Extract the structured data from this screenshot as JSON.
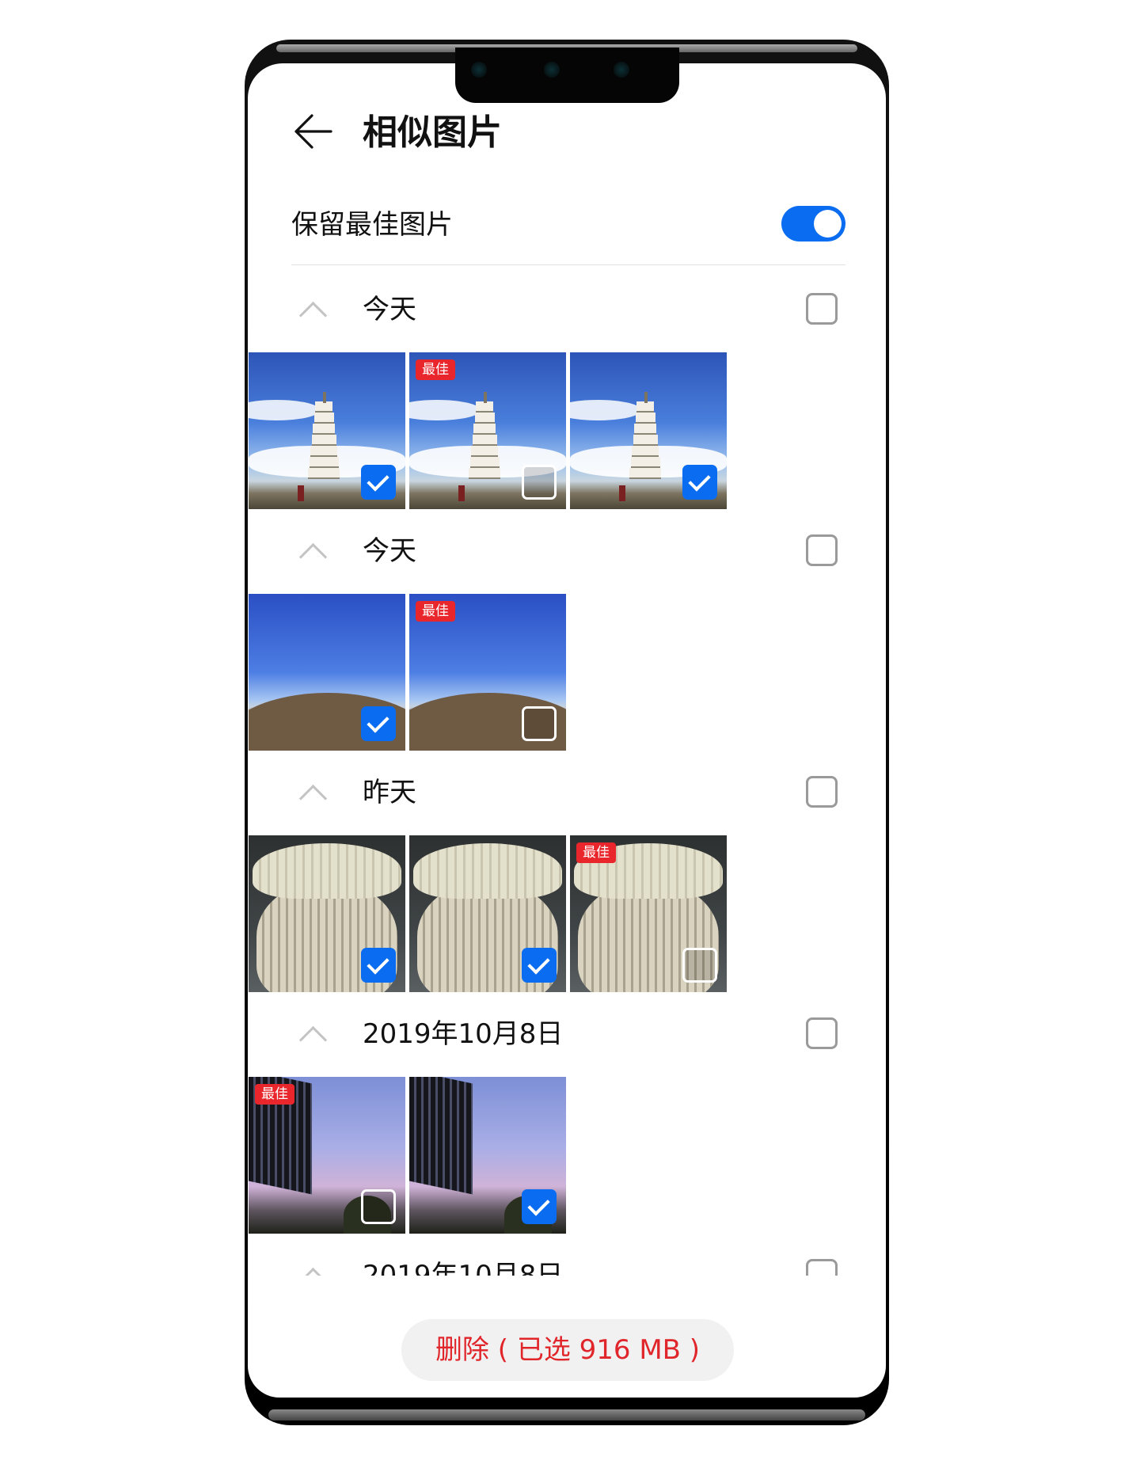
{
  "header": {
    "title": "相似图片",
    "back_icon": "arrow-left-icon"
  },
  "keep_best": {
    "label": "保留最佳图片",
    "enabled": true
  },
  "colors": {
    "accent": "#0a6cf0",
    "danger": "#e0262b",
    "best_badge": "#e8262b"
  },
  "groups": [
    {
      "label": "今天",
      "selected": false,
      "photos": [
        {
          "scene": "pagoda",
          "best": false,
          "selected": true
        },
        {
          "scene": "pagoda",
          "best": true,
          "selected": false
        },
        {
          "scene": "pagoda",
          "best": false,
          "selected": true
        }
      ]
    },
    {
      "label": "今天",
      "selected": false,
      "photos": [
        {
          "scene": "mountain",
          "best": false,
          "selected": true
        },
        {
          "scene": "mountain",
          "best": true,
          "selected": false
        }
      ]
    },
    {
      "label": "昨天",
      "selected": false,
      "photos": [
        {
          "scene": "vase",
          "best": false,
          "selected": true
        },
        {
          "scene": "vase",
          "best": false,
          "selected": true
        },
        {
          "scene": "vase",
          "best": true,
          "selected": false
        }
      ]
    },
    {
      "label": "2019年10月8日",
      "selected": false,
      "photos": [
        {
          "scene": "building",
          "best": true,
          "selected": false
        },
        {
          "scene": "building",
          "best": false,
          "selected": true
        }
      ]
    },
    {
      "label": "2019年10月8日",
      "selected": false,
      "photos": []
    }
  ],
  "best_badge_label": "最佳",
  "delete_button": {
    "label": "删除 ( 已选 916 MB )"
  }
}
